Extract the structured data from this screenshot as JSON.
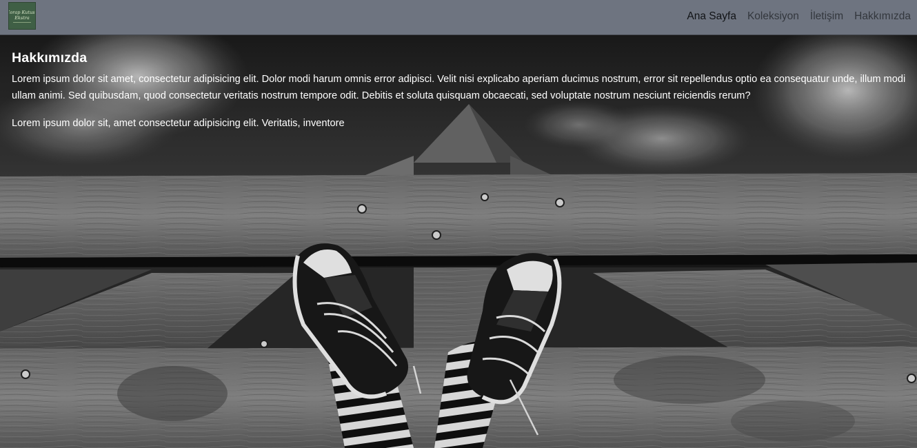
{
  "brand": {
    "logo_line1": "Çorap Kutusu",
    "logo_line2": "Ekstra"
  },
  "nav": {
    "items": [
      {
        "label": "Ana Sayfa"
      },
      {
        "label": "Koleksiyon"
      },
      {
        "label": "İletişim"
      },
      {
        "label": "Hakkımızda"
      }
    ]
  },
  "about": {
    "title": "Hakkımızda",
    "paragraph1": "Lorem ipsum dolor sit amet, consectetur adipisicing elit. Dolor modi harum omnis error adipisci. Velit nisi explicabo aperiam ducimus nostrum, error sit repellendus optio ea consequatur unde, illum modi ullam animi. Sed quibusdam, quod consectetur veritatis nostrum tempore odit. Debitis et soluta quisquam obcaecati, sed voluptate nostrum nesciunt reiciendis rerum?",
    "paragraph2": "Lorem ipsum dolor sit, amet consectetur adipisicing elit. Veritatis, inventore"
  },
  "colors": {
    "navbar_bg": "#6e7480",
    "logo_bg": "#3f5f45",
    "text_on_image": "#ffffff"
  },
  "icons": {
    "logo": "brand-logo"
  }
}
